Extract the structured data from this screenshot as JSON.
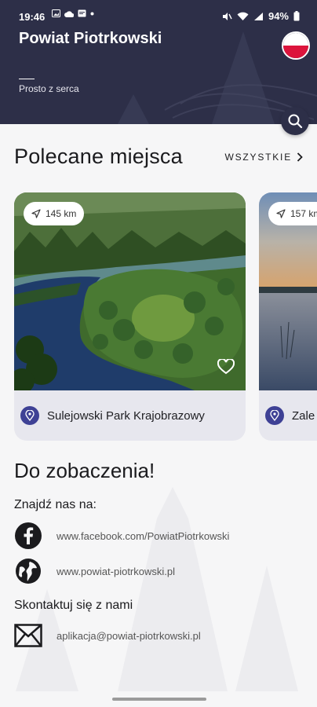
{
  "status_bar": {
    "time": "19:46",
    "battery": "94%"
  },
  "header": {
    "title": "Powiat Piotrkowski",
    "tagline": "Prosto z serca",
    "flag_colors": [
      "#ffffff",
      "#dc143c"
    ]
  },
  "featured": {
    "title": "Polecane miejsca",
    "see_all": "WSZYSTKIE",
    "places": [
      {
        "distance": "145 km",
        "name": "Sulejowski Park Krajobrazowy"
      },
      {
        "distance": "157 km",
        "name": "Zale"
      }
    ]
  },
  "to_see": {
    "title": "Do zobaczenia!",
    "find_us": "Znajdź nas na:",
    "facebook": "www.facebook.com/PowiatPiotrkowski",
    "website": "www.powiat-piotrkowski.pl",
    "contact_label": "Skontaktuj się z nami",
    "email": "aplikacja@powiat-piotrkowski.pl"
  },
  "icons": {
    "search": "search-icon",
    "navigation": "navigation-arrow-icon",
    "heart": "heart-icon",
    "pin": "location-pin-icon",
    "facebook": "facebook-icon",
    "globe": "globe-icon",
    "mail": "mail-icon"
  },
  "colors": {
    "header_bg": "#2d2f48",
    "accent": "#3e4195",
    "background": "#f6f6f7"
  }
}
